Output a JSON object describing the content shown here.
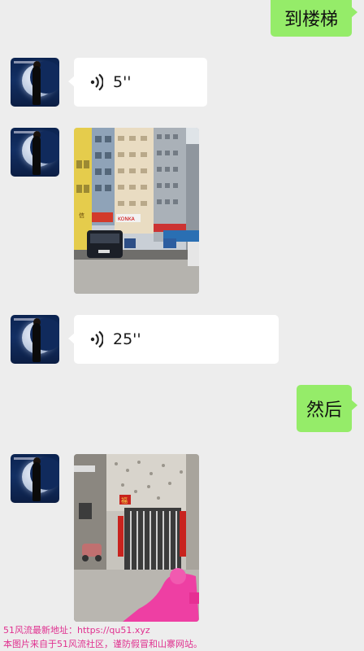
{
  "messages": {
    "m1_text": "到楼梯",
    "m2_voice_duration": "5''",
    "m4_voice_duration": "25''",
    "m5_text": "然后"
  },
  "photo1": {
    "sign_left": "信",
    "sign_shop": "KONKA"
  },
  "photo2": {
    "sign_top": "福"
  },
  "watermark": {
    "line1": "51风流最新地址：https://qu51.xyz",
    "line2": "本图片来自于51风流社区，谨防假冒和山寨网站。"
  },
  "colors": {
    "background": "#ededed",
    "sent_bubble": "#95ec69",
    "received_bubble": "#ffffff",
    "watermark": "#e0308f"
  },
  "icons": {
    "voice": "voice-wave-icon",
    "avatar": "contact-avatar"
  }
}
